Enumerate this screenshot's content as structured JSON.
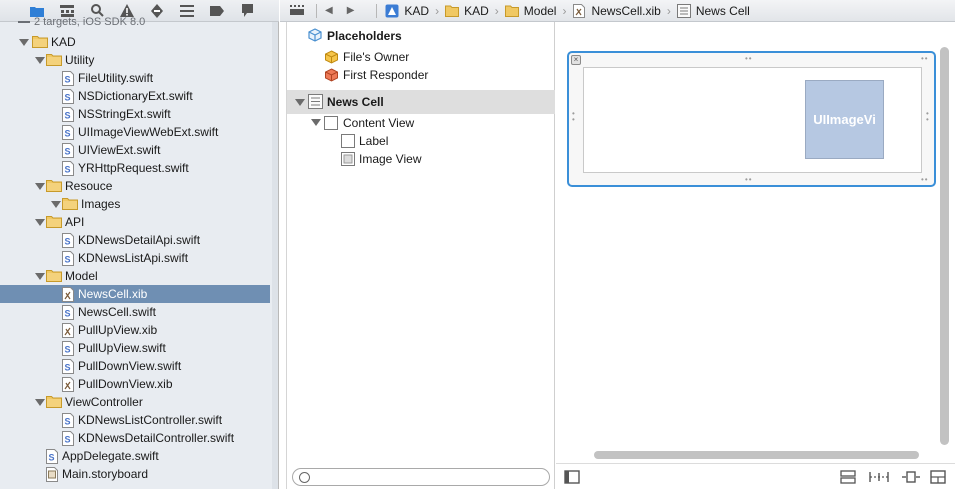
{
  "navigator": {
    "toolbar_icons": [
      "folder-icon",
      "hierarchy-icon",
      "search-icon",
      "warning-icon",
      "test-icon",
      "debug-icon",
      "breakpoint-icon",
      "log-icon"
    ],
    "subtitle": "2 targets, iOS SDK 8.0",
    "tree": [
      {
        "label": "KAD",
        "type": "folder",
        "level": 1,
        "expanded": true
      },
      {
        "label": "Utility",
        "type": "folder",
        "level": 2,
        "expanded": true
      },
      {
        "label": "FileUtility.swift",
        "type": "swift",
        "level": 3
      },
      {
        "label": "NSDictionaryExt.swift",
        "type": "swift",
        "level": 3
      },
      {
        "label": "NSStringExt.swift",
        "type": "swift",
        "level": 3
      },
      {
        "label": "UIImageViewWebExt.swift",
        "type": "swift",
        "level": 3
      },
      {
        "label": "UIViewExt.swift",
        "type": "swift",
        "level": 3
      },
      {
        "label": "YRHttpRequest.swift",
        "type": "swift",
        "level": 3
      },
      {
        "label": "Resouce",
        "type": "folder",
        "level": 2,
        "expanded": true
      },
      {
        "label": "Images",
        "type": "folder",
        "level": 3,
        "expanded": true
      },
      {
        "label": "API",
        "type": "folder",
        "level": 2,
        "expanded": true
      },
      {
        "label": "KDNewsDetailApi.swift",
        "type": "swift",
        "level": 3
      },
      {
        "label": "KDNewsListApi.swift",
        "type": "swift",
        "level": 3
      },
      {
        "label": "Model",
        "type": "folder",
        "level": 2,
        "expanded": true
      },
      {
        "label": "NewsCell.xib",
        "type": "xib",
        "level": 3,
        "selected": true
      },
      {
        "label": "NewsCell.swift",
        "type": "swift",
        "level": 3
      },
      {
        "label": "PullUpView.xib",
        "type": "xib",
        "level": 3
      },
      {
        "label": "PullUpView.swift",
        "type": "swift",
        "level": 3
      },
      {
        "label": "PullDownView.swift",
        "type": "swift",
        "level": 3
      },
      {
        "label": "PullDownView.xib",
        "type": "xib",
        "level": 3
      },
      {
        "label": "ViewController",
        "type": "folder",
        "level": 2,
        "expanded": true
      },
      {
        "label": "KDNewsListController.swift",
        "type": "swift",
        "level": 3
      },
      {
        "label": "KDNewsDetailController.swift",
        "type": "swift",
        "level": 3
      },
      {
        "label": "AppDelegate.swift",
        "type": "swift",
        "level": 2
      },
      {
        "label": "Main.storyboard",
        "type": "storyboard",
        "level": 2
      }
    ]
  },
  "jumpbar": {
    "crumbs": [
      {
        "label": "KAD",
        "icon": "project-icon"
      },
      {
        "label": "KAD",
        "icon": "folder-icon"
      },
      {
        "label": "Model",
        "icon": "folder-icon"
      },
      {
        "label": "NewsCell.xib",
        "icon": "xib-file-icon"
      },
      {
        "label": "News Cell",
        "icon": "view-icon"
      }
    ]
  },
  "outline": {
    "placeholders_label": "Placeholders",
    "files_owner": "File's Owner",
    "first_responder": "First Responder",
    "news_cell": "News Cell",
    "content_view": "Content View",
    "label": "Label",
    "image_view": "Image View",
    "filter_placeholder": ""
  },
  "canvas": {
    "image_view_text": "UIImageVi"
  },
  "colors": {
    "selection": "#6f8fb3",
    "cell_border": "#3a8fd8",
    "image_view_fill": "#b6c8e2"
  }
}
